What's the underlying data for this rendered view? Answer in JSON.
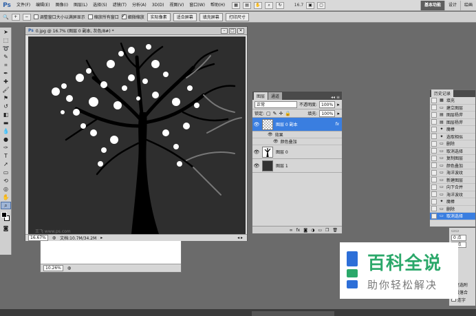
{
  "menubar": {
    "logo": "Ps",
    "items": [
      "文件(F)",
      "编辑(E)",
      "图像(I)",
      "图层(L)",
      "选择(S)",
      "滤镜(T)",
      "分析(A)",
      "3D(D)",
      "视图(V)",
      "窗口(W)",
      "帮助(H)"
    ],
    "zoom": "16.7",
    "workspaces": [
      "基本功能",
      "设计",
      "绘画"
    ]
  },
  "options": {
    "tool_icon": "🔍",
    "check1": "调整窗口大小以满屏显示",
    "check2": "缩放所有窗口",
    "check3": "细微缩放",
    "btn_actual": "实际像素",
    "btn_fit": "适合屏幕",
    "btn_fill": "填充屏幕",
    "btn_print": "打印尺寸"
  },
  "document": {
    "title": "0.jpg @ 16.7% (图层 0 副本, 灰色/8#) *",
    "watermark_small": "王飞 www.ps.com",
    "zoom": "16.67%",
    "docsize": "文档:10.7M/34.2M"
  },
  "document2": {
    "zoom": "10.26%"
  },
  "layers": {
    "tab_layers": "图层",
    "tab_channels": "通道",
    "blend_mode": "正常",
    "opacity_label": "不透明度:",
    "opacity_value": "100%",
    "lock_label": "锁定:",
    "fill_label": "填充:",
    "fill_value": "100%",
    "rows": [
      {
        "name": "图层 0 副本",
        "fx": "fx"
      },
      {
        "name": "图层 0"
      },
      {
        "name": "图层 1"
      }
    ],
    "effects_label": "效果",
    "effect_item": "颜色叠加",
    "footer_icons": [
      "∞",
      "fx",
      "◙",
      "◑",
      "▭",
      "❐",
      "🗑"
    ]
  },
  "history": {
    "tab": "历史记录",
    "items": [
      "填充",
      "建立图层",
      "图层杨斧",
      "图层杨斧",
      "魔棒",
      "选取相似",
      "删除",
      "取消选择",
      "复制图层",
      "颜色叠加",
      "海洋波纹",
      "新建图层",
      "向下合并",
      "海洋波纹",
      "魔棒",
      "删除",
      "取消选择"
    ],
    "selected_index": 16
  },
  "props": {
    "v1": "0 点",
    "v2": "0 点",
    "t1": "大尾选附",
    "t2": "随段落合",
    "t3": "连字"
  },
  "overlay": {
    "main": "百科全说",
    "sub": "助你轻松解决",
    "colors": {
      "green": "#2ba86a",
      "blue": "#2d6fd8",
      "gray": "#777777"
    }
  }
}
